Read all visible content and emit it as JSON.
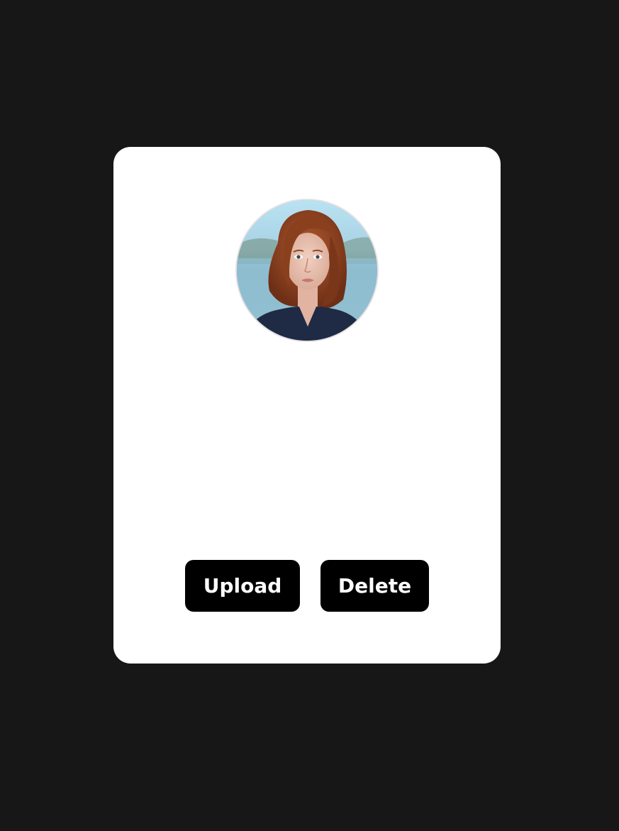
{
  "profile": {
    "avatar_icon": "profile-photo",
    "accent_border": "#e6e0e2"
  },
  "actions": {
    "upload_label": "Upload",
    "delete_label": "Delete"
  },
  "colors": {
    "background": "#171717",
    "card": "#ffffff",
    "button": "#000000",
    "button_text": "#ffffff"
  }
}
